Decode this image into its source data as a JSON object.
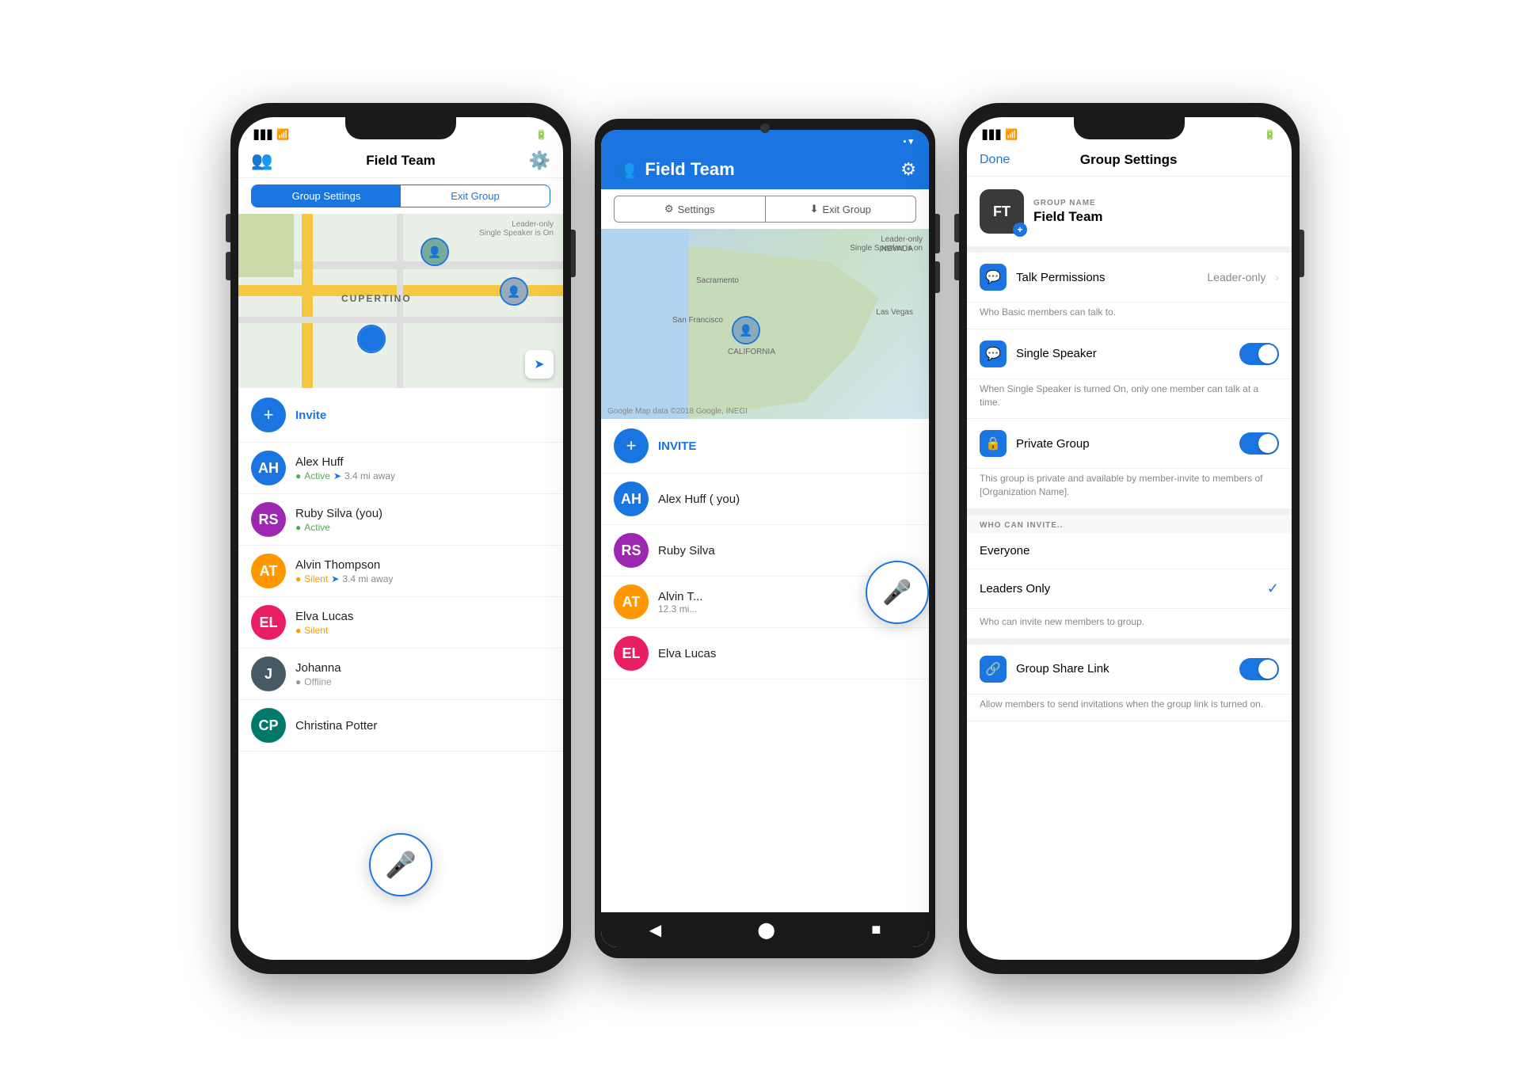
{
  "phone1": {
    "title": "Field Team",
    "buttons": {
      "group_settings": "Group Settings",
      "exit_group": "Exit Group",
      "invite": "Invite"
    },
    "badge": {
      "line1": "Leader-only",
      "line2": "Single Speaker is On"
    },
    "members": [
      {
        "name": "Alex Huff",
        "status": "Active",
        "distance": "3.4 mi away",
        "status_type": "active",
        "initials": "AH"
      },
      {
        "name": "Ruby Silva  (you)",
        "status": "Active",
        "distance": "",
        "status_type": "active",
        "initials": "RS"
      },
      {
        "name": "Alvin Thompson",
        "status": "Silent",
        "distance": "3.4 mi away",
        "status_type": "silent",
        "initials": "AT"
      },
      {
        "name": "Elva Lucas",
        "status": "Silent",
        "distance": "",
        "status_type": "silent",
        "initials": "EL"
      },
      {
        "name": "Johanna",
        "status": "Offline",
        "distance": "",
        "status_type": "offline",
        "initials": "J"
      },
      {
        "name": "Christina Potter",
        "status": "",
        "distance": "",
        "status_type": "offline",
        "initials": "CP"
      }
    ],
    "map": {
      "label": "CUPERTINO"
    }
  },
  "phone2": {
    "title": "Field Team",
    "buttons": {
      "settings": "Settings",
      "exit_group": "Exit Group",
      "invite": "INVITE"
    },
    "badge": {
      "line1": "Leader-only",
      "line2": "Single Speaker is on"
    },
    "members": [
      {
        "name": "Alex Huff ( you)",
        "initials": "AH",
        "distance": ""
      },
      {
        "name": "Ruby Silva",
        "initials": "RS",
        "distance": ""
      },
      {
        "name": "Alvin T...",
        "initials": "AT",
        "distance": "12.3 mi..."
      },
      {
        "name": "Elva Lucas",
        "initials": "EL",
        "distance": ""
      }
    ],
    "map": {
      "labels": [
        "NEVADA",
        "Sacramento",
        "San Francisco",
        "CALIFORNIA",
        "Las Vegas"
      ]
    }
  },
  "phone3": {
    "header": {
      "done": "Done",
      "title": "Group Settings"
    },
    "group": {
      "label": "GROUP NAME",
      "name": "Field Team",
      "initials": "FT"
    },
    "settings": [
      {
        "icon": "💬",
        "label": "Talk Permissions",
        "value": "Leader-only",
        "type": "nav",
        "desc": ""
      },
      {
        "icon": "💬",
        "label": "Single Speaker",
        "value": "",
        "type": "toggle",
        "desc": "When Single Speaker is turned On, only one member can talk at a time."
      },
      {
        "icon": "🔒",
        "label": "Private Group",
        "value": "",
        "type": "toggle",
        "desc": "This group is private and available by member-invite to members of [Organization Name]."
      }
    ],
    "who_invite": {
      "label": "WHO CAN INVITE..",
      "options": [
        {
          "name": "Everyone",
          "selected": false
        },
        {
          "name": "Leaders Only",
          "selected": true
        }
      ],
      "desc": "Who can invite new members to group."
    },
    "share": {
      "icon": "🔗",
      "label": "Group Share Link",
      "type": "toggle",
      "desc": "Allow members to send invitations when the group link is turned on."
    }
  }
}
